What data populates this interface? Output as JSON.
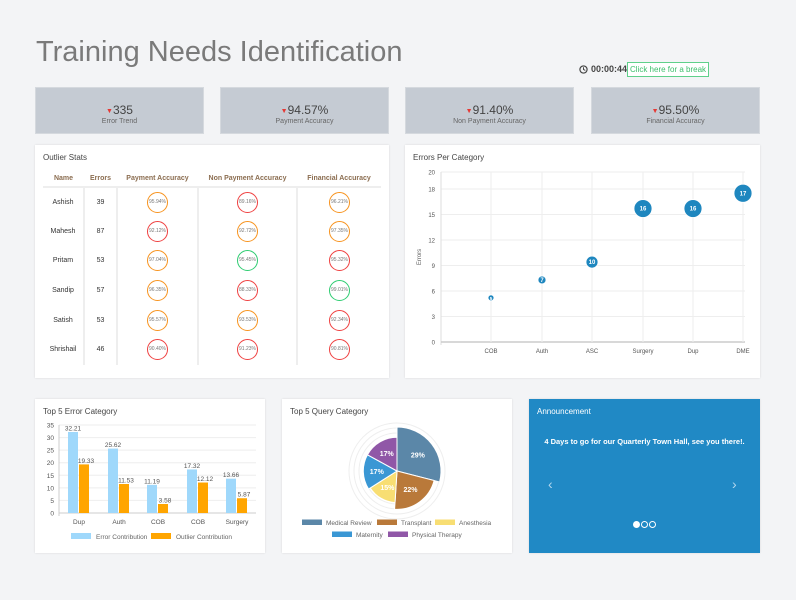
{
  "header": {
    "title": "Training Needs Identification",
    "timer": "00:00:44",
    "break_label": "Click here for a break"
  },
  "kpis": [
    {
      "value": "335",
      "label": "Error Trend",
      "trend": "down"
    },
    {
      "value": "94.57%",
      "label": "Payment Accuracy",
      "trend": "down"
    },
    {
      "value": "91.40%",
      "label": "Non Payment Accuracy",
      "trend": "down"
    },
    {
      "value": "95.50%",
      "label": "Financial Accuracy",
      "trend": "down"
    }
  ],
  "outlier": {
    "title": "Outlier Stats",
    "columns": [
      "Name",
      "Errors",
      "Payment Accuracy",
      "Non Payment Accuracy",
      "Financial Accuracy"
    ],
    "rows": [
      {
        "name": "Ashish",
        "errors": "39",
        "pay": "95.94%",
        "pay_c": "orange",
        "non": "89.16%",
        "non_c": "red",
        "fin": "96.21%",
        "fin_c": "orange"
      },
      {
        "name": "Mahesh",
        "errors": "87",
        "pay": "92.12%",
        "pay_c": "red",
        "non": "92.72%",
        "non_c": "orange",
        "fin": "97.35%",
        "fin_c": "orange"
      },
      {
        "name": "Pritam",
        "errors": "53",
        "pay": "97.04%",
        "pay_c": "orange",
        "non": "95.45%",
        "non_c": "green",
        "fin": "95.32%",
        "fin_c": "red"
      },
      {
        "name": "Sandip",
        "errors": "57",
        "pay": "96.35%",
        "pay_c": "orange",
        "non": "88.33%",
        "non_c": "red",
        "fin": "99.01%",
        "fin_c": "green"
      },
      {
        "name": "Satish",
        "errors": "53",
        "pay": "95.57%",
        "pay_c": "orange",
        "non": "93.53%",
        "non_c": "orange",
        "fin": "92.34%",
        "fin_c": "red"
      },
      {
        "name": "Shrishail",
        "errors": "46",
        "pay": "90.40%",
        "pay_c": "red",
        "non": "91.23%",
        "non_c": "red",
        "fin": "90.81%",
        "fin_c": "red"
      }
    ]
  },
  "colors": {
    "orange": "#f7931e",
    "red": "#ef4040",
    "green": "#2ecc71",
    "announce_bg": "#2089c5",
    "kpi_bg": "#c5cbd3"
  },
  "chart_data": [
    {
      "type": "scatter",
      "title": "Errors Per Category",
      "ylabel": "Errors",
      "categories": [
        "COB",
        "Auth",
        "ASC",
        "Surgery",
        "Dup",
        "DME"
      ],
      "values": [
        5.2,
        7.3,
        9.4,
        15.7,
        15.7,
        17.5
      ],
      "labels": [
        "5",
        "7",
        "10",
        "16",
        "16",
        "17"
      ],
      "yticks": [
        0,
        3,
        6,
        9,
        12,
        15,
        18,
        20
      ],
      "ylim": [
        0,
        20
      ],
      "grid": true,
      "color": "#1f87bf"
    },
    {
      "type": "bar",
      "title": "Top 5 Error Category",
      "categories": [
        "Dup",
        "Auth",
        "COB",
        "COB",
        "Surgery"
      ],
      "ylim": [
        0,
        35
      ],
      "yticks": [
        0,
        5,
        10,
        15,
        20,
        25,
        30,
        35
      ],
      "grid": true,
      "legend": "bottom",
      "series": [
        {
          "name": "Error Contribution",
          "values": [
            32.21,
            25.62,
            11.19,
            17.32,
            13.66
          ],
          "color": "#9fd8fb"
        },
        {
          "name": "Outlier Contribution",
          "values": [
            19.33,
            11.53,
            3.58,
            12.12,
            5.87
          ],
          "color": "#ffa500"
        }
      ]
    },
    {
      "type": "pie",
      "title": "Top 5 Query Category",
      "legend": "bottom",
      "slices": [
        {
          "name": "Medical Review",
          "value": 29,
          "label": "29%",
          "color": "#5b87a8"
        },
        {
          "name": "Transplant",
          "value": 22,
          "label": "22%",
          "color": "#b9793a"
        },
        {
          "name": "Anesthesia",
          "value": 15,
          "label": "15%",
          "color": "#f8de73"
        },
        {
          "name": "Maternity",
          "value": 17,
          "label": "17%",
          "color": "#3a97d4"
        },
        {
          "name": "Physical Therapy",
          "value": 17,
          "label": "17%",
          "color": "#9057a7"
        }
      ]
    }
  ],
  "announcement": {
    "title": "Announcement",
    "message": "4 Days to go for our Quarterly Town Hall, see you there!.",
    "slides": 3,
    "active": 0
  }
}
